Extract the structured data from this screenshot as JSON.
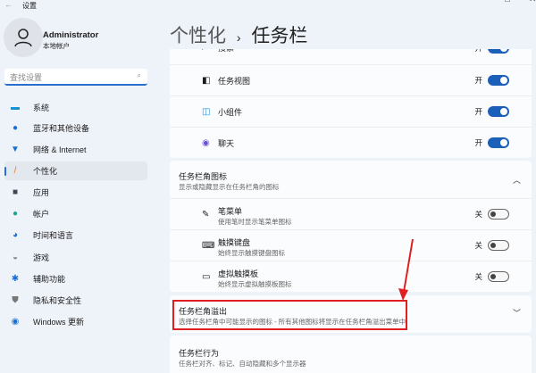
{
  "window": {
    "title": "设置",
    "back_icon": "arrow-left-icon"
  },
  "user": {
    "name": "Administrator",
    "account_type": "本地帐户"
  },
  "search": {
    "placeholder": "查找设置"
  },
  "sidebar": {
    "items": [
      {
        "label": "系统",
        "icon": "monitor-icon"
      },
      {
        "label": "蓝牙和其他设备",
        "icon": "bluetooth-icon"
      },
      {
        "label": "网络 & Internet",
        "icon": "wifi-icon"
      },
      {
        "label": "个性化",
        "icon": "brush-icon",
        "selected": true
      },
      {
        "label": "应用",
        "icon": "apps-icon"
      },
      {
        "label": "帐户",
        "icon": "person-icon"
      },
      {
        "label": "时间和语言",
        "icon": "globe-clock-icon"
      },
      {
        "label": "游戏",
        "icon": "gamepad-icon"
      },
      {
        "label": "辅助功能",
        "icon": "accessibility-icon"
      },
      {
        "label": "隐私和安全性",
        "icon": "shield-icon"
      },
      {
        "label": "Windows 更新",
        "icon": "update-icon"
      }
    ]
  },
  "header": {
    "breadcrumb": "个性化",
    "separator": "›",
    "title": "任务栏"
  },
  "taskbar_items": [
    {
      "label": "搜索",
      "state": "开",
      "on": true
    },
    {
      "label": "任务视图",
      "state": "开",
      "on": true
    },
    {
      "label": "小组件",
      "state": "开",
      "on": true
    },
    {
      "label": "聊天",
      "state": "开",
      "on": true
    }
  ],
  "corner_icons": {
    "title": "任务栏角图标",
    "subtitle": "显示或隐藏显示在任务栏角的图标",
    "expanded": true,
    "items": [
      {
        "label": "笔菜单",
        "sub": "使用笔时显示笔菜单图标",
        "state": "关",
        "on": false
      },
      {
        "label": "触摸键盘",
        "sub": "始终显示触摸键盘图标",
        "state": "关",
        "on": false
      },
      {
        "label": "虚拟触摸板",
        "sub": "始终显示虚拟触摸板图标",
        "state": "关",
        "on": false
      }
    ]
  },
  "corner_overflow": {
    "title": "任务栏角溢出",
    "subtitle": "选择任务栏角中可能显示的图标 - 所有其他图标将显示在任务栏角溢出菜单中"
  },
  "behaviors": {
    "title": "任务栏行为",
    "subtitle": "任务栏对齐、标记、自动隐藏和多个显示器"
  },
  "colors": {
    "accent": "#1c5fb8",
    "annotation": "#e02020"
  }
}
